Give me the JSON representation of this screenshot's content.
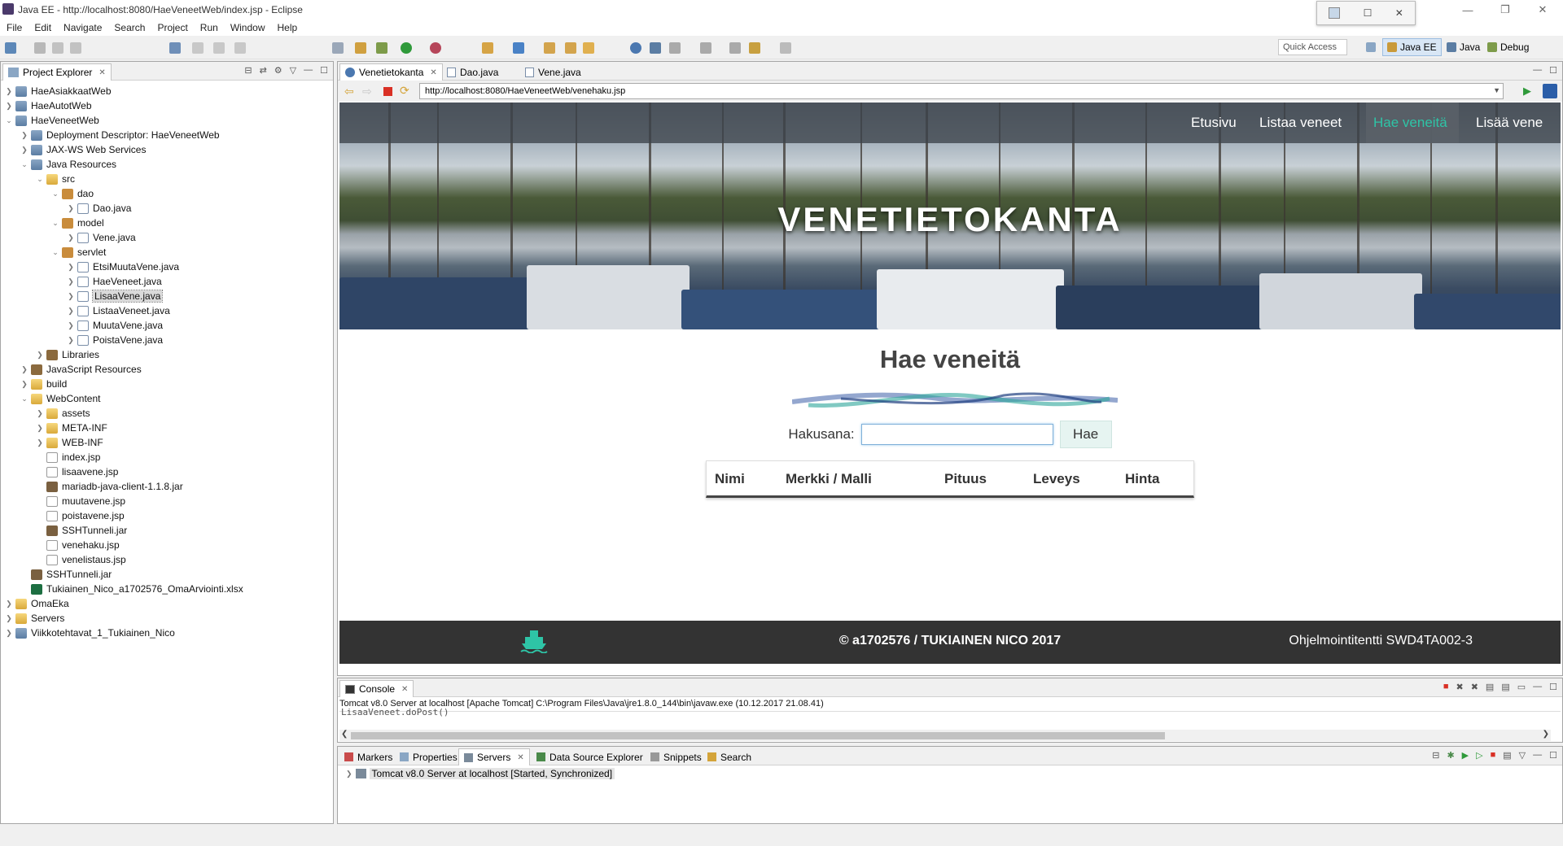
{
  "window": {
    "title": "Java EE - http://localhost:8080/HaeVeneetWeb/index.jsp - Eclipse"
  },
  "menu": [
    "File",
    "Edit",
    "Navigate",
    "Search",
    "Project",
    "Run",
    "Window",
    "Help"
  ],
  "toolbar": {
    "quick_access": "Quick Access",
    "perspectives": [
      "Java EE",
      "Java",
      "Debug"
    ]
  },
  "project_explorer": {
    "tab_label": "Project Explorer",
    "tree": [
      {
        "label": "HaeAsiakkaatWeb",
        "depth": 0,
        "icon": "project",
        "arrow": "collapsed"
      },
      {
        "label": "HaeAutotWeb",
        "depth": 0,
        "icon": "project",
        "arrow": "collapsed"
      },
      {
        "label": "HaeVeneetWeb",
        "depth": 0,
        "icon": "project",
        "arrow": "expanded"
      },
      {
        "label": "Deployment Descriptor: HaeVeneetWeb",
        "depth": 1,
        "icon": "project",
        "arrow": "collapsed"
      },
      {
        "label": "JAX-WS Web Services",
        "depth": 1,
        "icon": "project",
        "arrow": "collapsed"
      },
      {
        "label": "Java Resources",
        "depth": 1,
        "icon": "project",
        "arrow": "expanded"
      },
      {
        "label": "src",
        "depth": 2,
        "icon": "folder",
        "arrow": "expanded"
      },
      {
        "label": "dao",
        "depth": 3,
        "icon": "package",
        "arrow": "expanded"
      },
      {
        "label": "Dao.java",
        "depth": 4,
        "icon": "java",
        "arrow": "collapsed"
      },
      {
        "label": "model",
        "depth": 3,
        "icon": "package",
        "arrow": "expanded"
      },
      {
        "label": "Vene.java",
        "depth": 4,
        "icon": "java",
        "arrow": "collapsed"
      },
      {
        "label": "servlet",
        "depth": 3,
        "icon": "package",
        "arrow": "expanded"
      },
      {
        "label": "EtsiMuutaVene.java",
        "depth": 4,
        "icon": "java",
        "arrow": "collapsed"
      },
      {
        "label": "HaeVeneet.java",
        "depth": 4,
        "icon": "java",
        "arrow": "collapsed"
      },
      {
        "label": "LisaaVene.java",
        "depth": 4,
        "icon": "java",
        "arrow": "collapsed",
        "selected": true
      },
      {
        "label": "ListaaVeneet.java",
        "depth": 4,
        "icon": "java",
        "arrow": "collapsed"
      },
      {
        "label": "MuutaVene.java",
        "depth": 4,
        "icon": "java",
        "arrow": "collapsed"
      },
      {
        "label": "PoistaVene.java",
        "depth": 4,
        "icon": "java",
        "arrow": "collapsed"
      },
      {
        "label": "Libraries",
        "depth": 2,
        "icon": "library",
        "arrow": "collapsed"
      },
      {
        "label": "JavaScript Resources",
        "depth": 1,
        "icon": "library",
        "arrow": "collapsed"
      },
      {
        "label": "build",
        "depth": 1,
        "icon": "folder",
        "arrow": "collapsed"
      },
      {
        "label": "WebContent",
        "depth": 1,
        "icon": "folder",
        "arrow": "expanded"
      },
      {
        "label": "assets",
        "depth": 2,
        "icon": "folder",
        "arrow": "collapsed"
      },
      {
        "label": "META-INF",
        "depth": 2,
        "icon": "folder",
        "arrow": "collapsed"
      },
      {
        "label": "WEB-INF",
        "depth": 2,
        "icon": "folder",
        "arrow": "collapsed"
      },
      {
        "label": "index.jsp",
        "depth": 2,
        "icon": "file",
        "arrow": "none"
      },
      {
        "label": "lisaavene.jsp",
        "depth": 2,
        "icon": "file",
        "arrow": "none"
      },
      {
        "label": "mariadb-java-client-1.1.8.jar",
        "depth": 2,
        "icon": "jar",
        "arrow": "none"
      },
      {
        "label": "muutavene.jsp",
        "depth": 2,
        "icon": "file",
        "arrow": "none"
      },
      {
        "label": "poistavene.jsp",
        "depth": 2,
        "icon": "file",
        "arrow": "none"
      },
      {
        "label": "SSHTunneli.jar",
        "depth": 2,
        "icon": "jar",
        "arrow": "none"
      },
      {
        "label": "venehaku.jsp",
        "depth": 2,
        "icon": "file",
        "arrow": "none"
      },
      {
        "label": "venelistaus.jsp",
        "depth": 2,
        "icon": "file",
        "arrow": "none"
      },
      {
        "label": "SSHTunneli.jar",
        "depth": 1,
        "icon": "jar",
        "arrow": "none"
      },
      {
        "label": "Tukiainen_Nico_a1702576_OmaArviointi.xlsx",
        "depth": 1,
        "icon": "xls",
        "arrow": "none"
      },
      {
        "label": "OmaEka",
        "depth": 0,
        "icon": "folder",
        "arrow": "collapsed"
      },
      {
        "label": "Servers",
        "depth": 0,
        "icon": "folder",
        "arrow": "collapsed"
      },
      {
        "label": "Viikkotehtavat_1_Tukiainen_Nico",
        "depth": 0,
        "icon": "project",
        "arrow": "collapsed"
      }
    ]
  },
  "editor": {
    "tabs": [
      "Venetietokanta",
      "Dao.java",
      "Vene.java"
    ],
    "url": "http://localhost:8080/HaeVeneetWeb/venehaku.jsp"
  },
  "webpage": {
    "nav": [
      "Etusivu",
      "Listaa veneet",
      "Hae veneitä",
      "Lisää vene"
    ],
    "active_nav": "Hae veneitä",
    "accent_color": "#2ec4a6",
    "hero_title": "VENETIETOKANTA",
    "heading": "Hae veneitä",
    "search_label": "Hakusana:",
    "search_value": "",
    "search_button": "Hae",
    "table_headers": [
      "Nimi",
      "Merkki / Malli",
      "Pituus",
      "Leveys",
      "Hinta"
    ],
    "footer_copy": "© a1702576 / TUKIAINEN NICO 2017",
    "footer_course": "Ohjelmointitentti SWD4TA002-3"
  },
  "console": {
    "tab_label": "Console",
    "launch": "Tomcat v8.0 Server at localhost [Apache Tomcat] C:\\Program Files\\Java\\jre1.8.0_144\\bin\\javaw.exe (10.12.2017 21.08.41)",
    "output": "LisaaVeneet.doPost()"
  },
  "bottom_panel": {
    "tabs": [
      "Markers",
      "Properties",
      "Servers",
      "Data Source Explorer",
      "Snippets",
      "Search"
    ],
    "server_entry": "Tomcat v8.0 Server at localhost  [Started, Synchronized]"
  }
}
